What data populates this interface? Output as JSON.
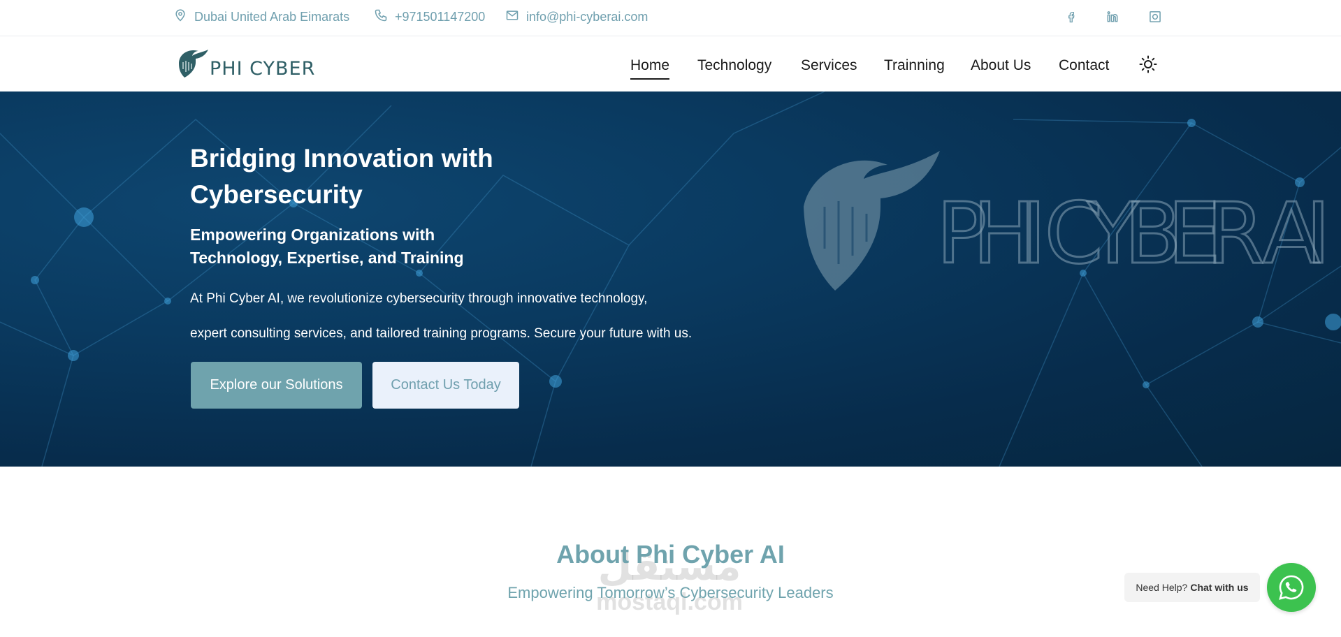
{
  "topbar": {
    "location": "Dubai United Arab Eimarats",
    "phone": "+971501147200",
    "email": "info@phi-cyberai.com",
    "icons": [
      "location-icon",
      "phone-icon",
      "mail-icon",
      "facebook-icon",
      "linkedin-icon",
      "instagram-icon"
    ]
  },
  "brand": {
    "logo_text": "PHI CYBER AI"
  },
  "nav": {
    "items": [
      {
        "label": "Home",
        "active": true
      },
      {
        "label": "Technology"
      },
      {
        "label": "Services"
      },
      {
        "label": "Trainning"
      },
      {
        "label": "About Us"
      },
      {
        "label": "Contact"
      }
    ],
    "theme_icon": "sun-icon"
  },
  "hero": {
    "title": "Bridging Innovation with Cybersecurity",
    "subtitle": "Empowering Organizations with Technology, Expertise, and Training",
    "text_line1": "At Phi Cyber AI, we revolutionize cybersecurity through innovative technology,",
    "text_line2": "expert consulting services, and tailored training programs. Secure your future with us.",
    "primary_button": "Explore our Solutions",
    "secondary_button": "Contact Us Today",
    "logo_text": "PHI CYBER AI"
  },
  "about": {
    "title": "About Phi Cyber AI",
    "subtitle": "Empowering Tomorrow’s Cybersecurity Leaders"
  },
  "watermark": {
    "arabic": "مستقل",
    "latin": "mostaql.com"
  },
  "chat": {
    "prefix": "Need Help?",
    "action": "Chat with us",
    "icon": "whatsapp-icon"
  },
  "colors": {
    "accent": "#6fa3ad",
    "hero_bg": "#0a3a60",
    "whatsapp": "#3cc24f",
    "secondary_btn_bg": "#eaf1fb"
  }
}
